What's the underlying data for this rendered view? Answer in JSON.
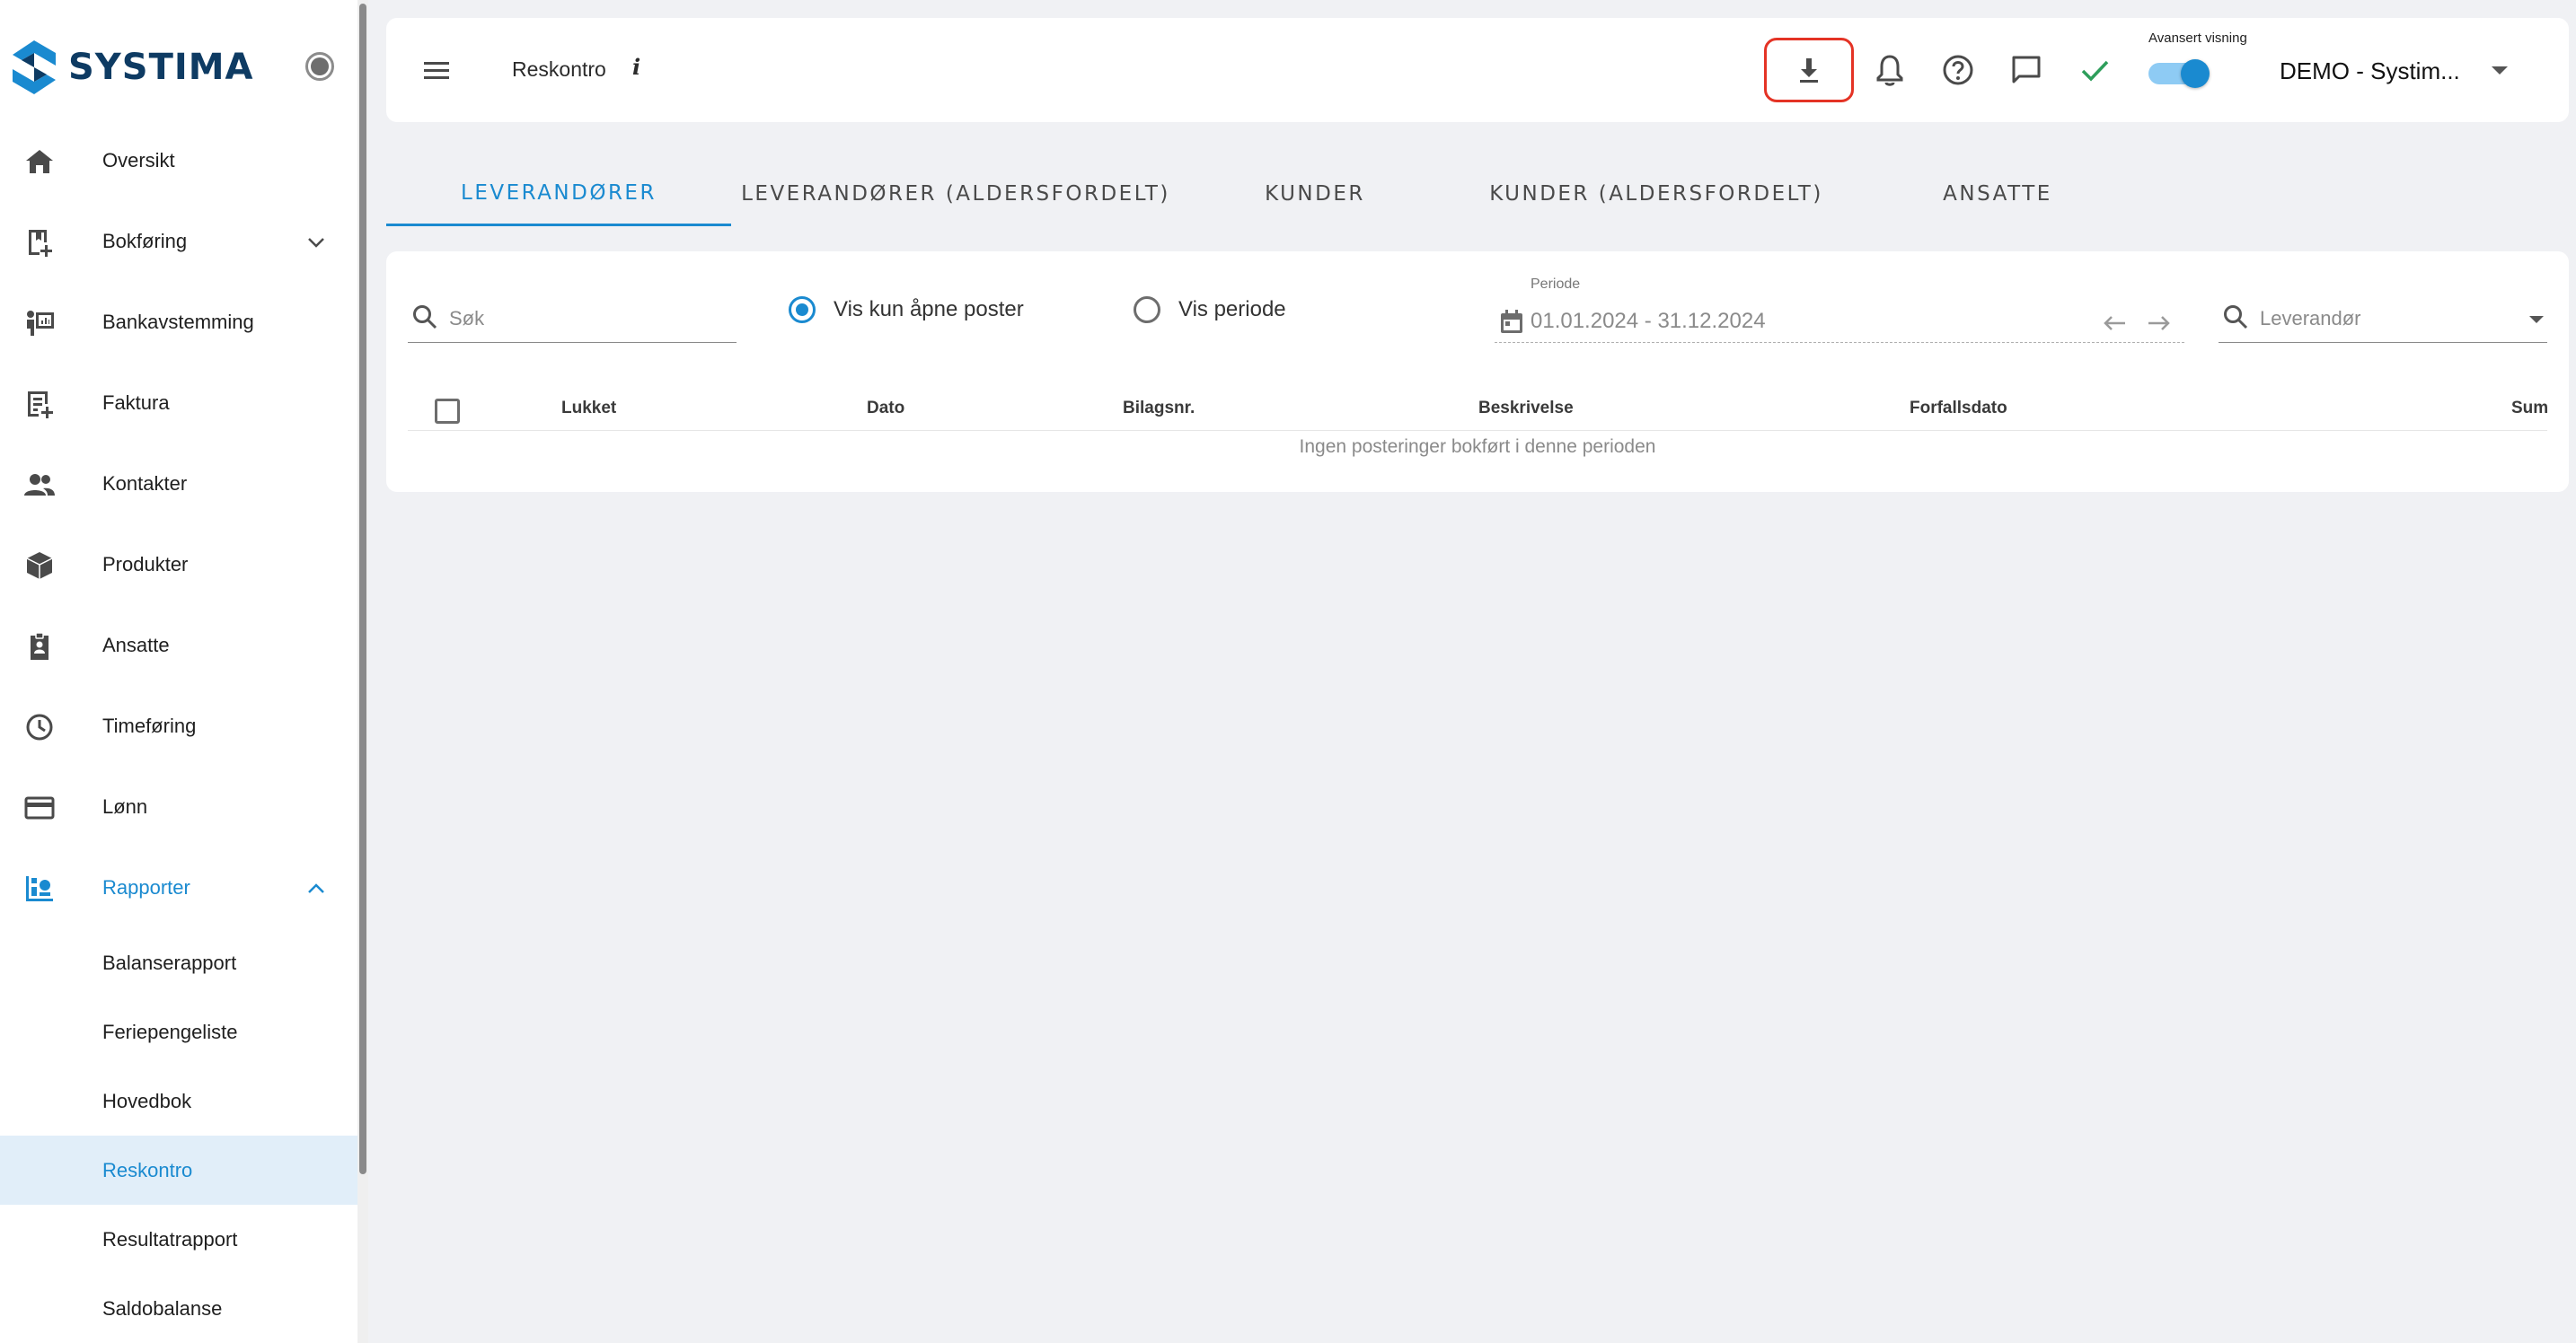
{
  "app": {
    "brand": "SYSTIMA",
    "page_title": "Reskontro",
    "info_mark": "i"
  },
  "sidebar": {
    "items": [
      {
        "label": "Oversikt",
        "icon": "home-icon"
      },
      {
        "label": "Bokføring",
        "icon": "book-plus-icon",
        "expandable": true,
        "expanded": false
      },
      {
        "label": "Bankavstemming",
        "icon": "bank-reconcile-icon"
      },
      {
        "label": "Faktura",
        "icon": "invoice-icon"
      },
      {
        "label": "Kontakter",
        "icon": "people-icon"
      },
      {
        "label": "Produkter",
        "icon": "box-icon"
      },
      {
        "label": "Ansatte",
        "icon": "badge-icon"
      },
      {
        "label": "Timeføring",
        "icon": "clock-icon"
      },
      {
        "label": "Lønn",
        "icon": "card-icon"
      },
      {
        "label": "Rapporter",
        "icon": "reports-icon",
        "expandable": true,
        "expanded": true,
        "active": true
      }
    ],
    "sub_items": [
      {
        "label": "Balanserapport"
      },
      {
        "label": "Feriepengeliste"
      },
      {
        "label": "Hovedbok"
      },
      {
        "label": "Reskontro",
        "selected": true
      },
      {
        "label": "Resultatrapport"
      },
      {
        "label": "Saldobalanse"
      }
    ]
  },
  "topbar": {
    "icons": [
      "menu-icon",
      "download-icon",
      "bell-icon",
      "help-icon",
      "chat-icon",
      "check-icon"
    ],
    "advanced_view_label": "Avansert visning",
    "advanced_view_on": true,
    "company": "DEMO - Systim..."
  },
  "tabs": [
    {
      "label": "LEVERANDØRER",
      "active": true
    },
    {
      "label": "LEVERANDØRER (ALDERSFORDELT)"
    },
    {
      "label": "KUNDER"
    },
    {
      "label": "KUNDER (ALDERSFORDELT)"
    },
    {
      "label": "ANSATTE"
    }
  ],
  "filters": {
    "search_placeholder": "Søk",
    "radio_open_posts": "Vis kun åpne poster",
    "radio_period": "Vis periode",
    "selected_radio": "open_posts",
    "period_label": "Periode",
    "period_value": "01.01.2024 - 31.12.2024",
    "supplier_placeholder": "Leverandør"
  },
  "table": {
    "columns": [
      "Lukket",
      "Dato",
      "Bilagsnr.",
      "Beskrivelse",
      "Forfallsdato",
      "Sum"
    ],
    "rows": [],
    "empty_message": "Ingen posteringer bokført i denne perioden"
  },
  "colors": {
    "accent": "#1a8ad0",
    "brand_dark": "#0e3b63",
    "highlight_red": "#e43325",
    "success": "#2e9e5b"
  }
}
